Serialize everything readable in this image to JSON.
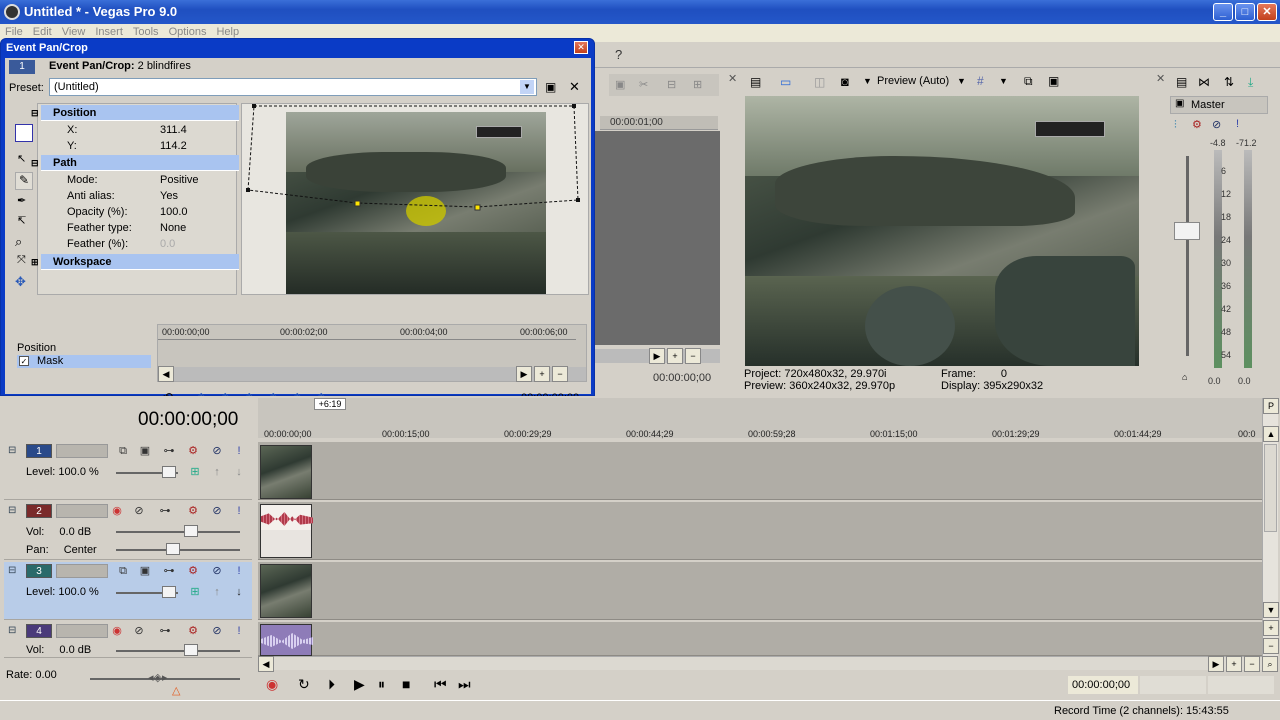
{
  "window": {
    "title": "Untitled * - Vegas Pro 9.0"
  },
  "menu": [
    "File",
    "Edit",
    "View",
    "Insert",
    "Tools",
    "Options",
    "Help"
  ],
  "dialog": {
    "title": "Event Pan/Crop",
    "track_num": "1",
    "header": "Event Pan/Crop:",
    "header_value": "2 blindfires",
    "preset_label": "Preset:",
    "preset_value": "(Untitled)",
    "sections": {
      "position": "Position",
      "path": "Path",
      "workspace": "Workspace"
    },
    "position": {
      "x_label": "X:",
      "x_value": "311.4",
      "y_label": "Y:",
      "y_value": "114.2"
    },
    "path": {
      "mode_label": "Mode:",
      "mode_value": "Positive",
      "aa_label": "Anti alias:",
      "aa_value": "Yes",
      "opacity_label": "Opacity (%):",
      "opacity_value": "100.0",
      "ftype_label": "Feather type:",
      "ftype_value": "None",
      "feather_label": "Feather (%):",
      "feather_value": "0.0"
    },
    "keyframe_tracks": {
      "position": "Position",
      "mask": "Mask"
    },
    "ruler": [
      "00:00:00;00",
      "00:00:02;00",
      "00:00:04;00",
      "00:00:06;00"
    ],
    "time": "00:00:00;00"
  },
  "middle": {
    "ruler": "00:00:01;00",
    "time": "00:00:00;00"
  },
  "preview": {
    "mode": "Preview (Auto)",
    "project_label": "Project:",
    "project_value": "720x480x32, 29.970i",
    "preview_label": "Preview:",
    "preview_value": "360x240x32, 29.970p",
    "frame_label": "Frame:",
    "frame_value": "0",
    "display_label": "Display:",
    "display_value": "395x290x32"
  },
  "master": {
    "label": "Master",
    "left_peak": "-4.8",
    "right_peak": "-71.2",
    "scale": [
      "6",
      "12",
      "18",
      "24",
      "30",
      "36",
      "42",
      "48",
      "54"
    ],
    "left_bottom": "0.0",
    "right_bottom": "0.0"
  },
  "timeline": {
    "time": "00:00:00;00",
    "marker": "+6:19",
    "ruler": [
      "00:00:00;00",
      "00:00:15;00",
      "00:00:29;29",
      "00:00:44;29",
      "00:00:59;28",
      "00:01:15;00",
      "00:01:29;29",
      "00:01:44;29",
      "00:0"
    ],
    "tracks": [
      {
        "num": "1",
        "color": "#2a4a8a",
        "row1": "Level:",
        "row1v": "100.0 %"
      },
      {
        "num": "2",
        "color": "#7a2a2a",
        "row1": "Vol:",
        "row1v": "0.0 dB",
        "row2": "Pan:",
        "row2v": "Center"
      },
      {
        "num": "3",
        "color": "#2a6a6a",
        "row1": "Level:",
        "row1v": "100.0 %"
      },
      {
        "num": "4",
        "color": "#4a3a7a",
        "row1": "Vol:",
        "row1v": "0.0 dB"
      }
    ],
    "rate": "Rate: 0.00",
    "transport_time": "00:00:00;00"
  },
  "status": {
    "record": "Record Time (2 channels): 15:43:55"
  }
}
